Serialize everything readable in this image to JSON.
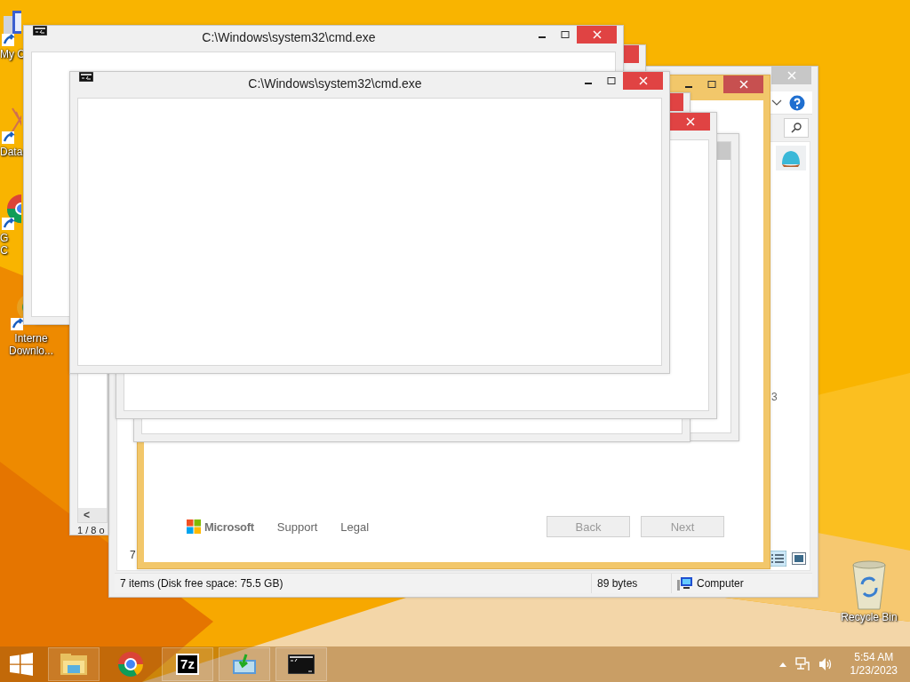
{
  "desktop": {
    "icons": [
      {
        "kind": "computer",
        "lines": [
          "My C"
        ]
      },
      {
        "kind": "database",
        "lines": [
          "Data"
        ]
      },
      {
        "kind": "chrome",
        "lines": [
          "G",
          "C"
        ]
      },
      {
        "kind": "downloader",
        "lines": [
          "Interne",
          "Downlo..."
        ]
      },
      {
        "kind": "recycle",
        "lines": [
          "Recycle Bin"
        ]
      }
    ]
  },
  "windows": [
    {
      "kind": "console",
      "title": "C:\\Windows\\system32\\cmd.exe"
    },
    {
      "kind": "console",
      "title": "C:\\Windows\\system32\\cmd.exe"
    },
    {
      "kind": "blank"
    },
    {
      "kind": "blank"
    },
    {
      "kind": "blank"
    },
    {
      "kind": "panel"
    },
    {
      "kind": "viewer",
      "page": "1 / 8 o",
      "scroll_glyph": "<"
    },
    {
      "kind": "setup",
      "brand": "Microsoft",
      "links": [
        "Support",
        "Legal"
      ],
      "buttons": [
        {
          "label": "Back",
          "disabled": true
        },
        {
          "label": "Next",
          "disabled": true
        }
      ]
    },
    {
      "kind": "explorer",
      "status": [
        "7 items (Disk free space: 75.5 GB)",
        "89 bytes",
        "Computer"
      ],
      "partial_texts": [
        "7",
        "3"
      ]
    }
  ],
  "taskbar": {
    "apps": [
      {
        "kind": "explorer"
      },
      {
        "kind": "chrome"
      },
      {
        "kind": "archiver",
        "text": "7z"
      },
      {
        "kind": "installer"
      },
      {
        "kind": "console"
      }
    ],
    "clock": {
      "time": "5:54 AM",
      "date": "1/23/2023"
    }
  }
}
